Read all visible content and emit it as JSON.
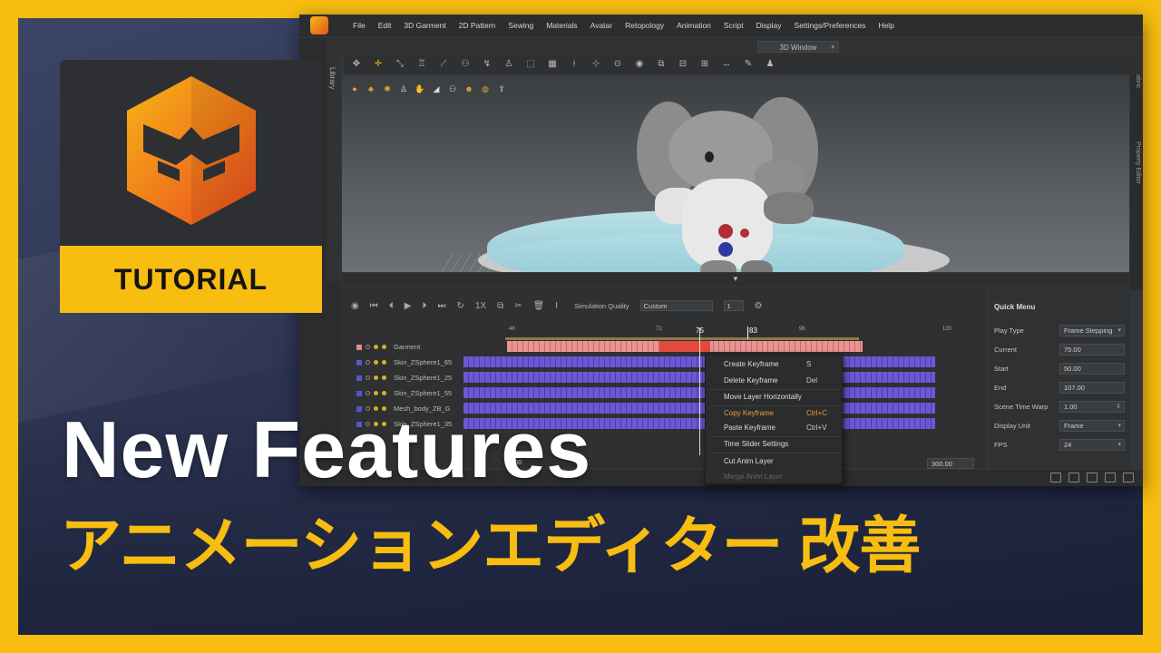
{
  "app": {
    "menu": [
      "File",
      "Edit",
      "3D Garment",
      "2D Pattern",
      "Sewing",
      "Materials",
      "Avatar",
      "Retopology",
      "Animation",
      "Script",
      "Display",
      "Settings/Preferences",
      "Help"
    ],
    "window_select": "3D Window",
    "library_label": "Library",
    "fabric_label": "Fabric",
    "property_label": "Property Editor"
  },
  "animation_editor": {
    "simulation_quality_label": "Simulation Quality",
    "simulation_quality_value": "Custom",
    "quality_step": "1",
    "ruler_ticks": [
      "48",
      "72",
      "75",
      "83",
      "96",
      "120"
    ],
    "current_frame_label": "75",
    "marker_label": "83",
    "tracks": [
      {
        "name": "Garment",
        "color": "#e08a8a"
      },
      {
        "name": "Skin_ZSphere1_65",
        "color": "#5b52d0"
      },
      {
        "name": "Skin_ZSphere1_25",
        "color": "#5b52d0"
      },
      {
        "name": "Skin_ZSphere1_55",
        "color": "#5b52d0"
      },
      {
        "name": "Mesh_body_ZB_G",
        "color": "#5b52d0"
      },
      {
        "name": "Skin_ZSphere1_35",
        "color": "#5b52d0"
      }
    ],
    "range_start": ".00",
    "range_end": "300.00"
  },
  "context_menu": {
    "items": [
      {
        "label": "Create Keyframe",
        "shortcut": "S"
      },
      {
        "label": "Delete Keyframe",
        "shortcut": "Del"
      },
      {
        "label": "Move Layer Horizontally",
        "shortcut": ""
      },
      {
        "label": "Copy Keyframe",
        "shortcut": "Ctrl+C"
      },
      {
        "label": "Paste Keyframe",
        "shortcut": "Ctrl+V"
      },
      {
        "label": "Time Slider Settings",
        "shortcut": ""
      },
      {
        "label": "Cut Anim Layer",
        "shortcut": ""
      },
      {
        "label": "Merge Anim Layer",
        "shortcut": ""
      }
    ]
  },
  "quick_menu": {
    "title": "Quick Menu",
    "play_type_label": "Play Type",
    "play_type_value": "Frame Stepping",
    "current_label": "Current",
    "current_value": "75.00",
    "start_label": "Start",
    "start_value": "50.00",
    "end_label": "End",
    "end_value": "107.00",
    "warp_label": "Scene Time Warp",
    "warp_value": "1.00",
    "unit_label": "Display Unit",
    "unit_value": "Frame",
    "fps_label": "FPS",
    "fps_value": "24"
  },
  "branding": {
    "tutorial": "TUTORIAL",
    "headline": "New Features",
    "subline": "アニメーションエディター 改善",
    "accent": "#f7bd10"
  }
}
